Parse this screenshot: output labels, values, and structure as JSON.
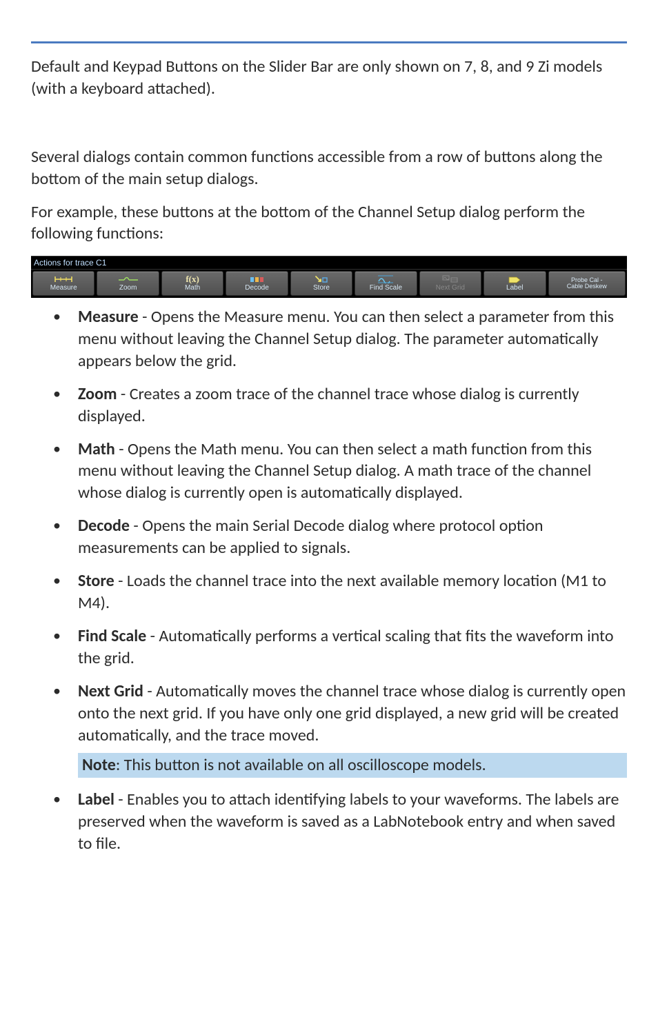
{
  "intro_para": "Default and Keypad Buttons on the Slider Bar are only shown on 7, 8, and 9 Zi models (with a keyboard attached).",
  "para2": "Several dialogs contain common functions accessible from a row of buttons along the bottom of the main setup dialogs.",
  "para3": "For example, these buttons at the bottom of the Channel Setup dialog perform the following functions:",
  "toolbar": {
    "title": "Actions for trace C1",
    "buttons": {
      "measure": "Measure",
      "zoom": "Zoom",
      "math": "Math",
      "math_icon_text": "f(x)",
      "decode": "Decode",
      "store": "Store",
      "findscale": "Find Scale",
      "nextgrid": "Next Grid",
      "label": "Label",
      "probecal_line1": "Probe Cal -",
      "probecal_line2": "Cable Deskew"
    }
  },
  "items": {
    "measure": {
      "title": "Measure",
      "text": " - Opens the Measure menu. You can then select a parameter from this menu without leaving the Channel Setup dialog. The parameter automatically appears below the grid."
    },
    "zoom": {
      "title": "Zoom",
      "text": " - Creates a zoom trace of the channel trace whose dialog is currently displayed."
    },
    "math": {
      "title": "Math",
      "text": " - Opens the Math menu. You can then select a math function from this menu without leaving the Channel Setup dialog. A math trace of the channel whose dialog is currently open is automatically displayed."
    },
    "decode": {
      "title": "Decode",
      "text": " - Opens the main Serial Decode dialog where protocol option measurements can be applied to signals."
    },
    "store": {
      "title": "Store",
      "text": " - Loads the channel trace into the next available memory location (M1 to M4)."
    },
    "findscale": {
      "title": "Find Scale",
      "text": " - Automatically performs a vertical scaling that fits the waveform into the grid."
    },
    "nextgrid": {
      "title": "Next Grid",
      "text": " - Automatically moves the channel trace whose dialog is currently open onto the next grid. If you have only one grid displayed, a new grid will be created automatically, and the trace moved."
    },
    "note": {
      "title": "Note",
      "text": ": This button is not available on all oscilloscope models."
    },
    "label": {
      "title": "Label",
      "text": " - Enables you to attach identifying labels to your waveforms. The labels are preserved when the waveform is saved as a LabNotebook entry and when saved to file."
    }
  }
}
